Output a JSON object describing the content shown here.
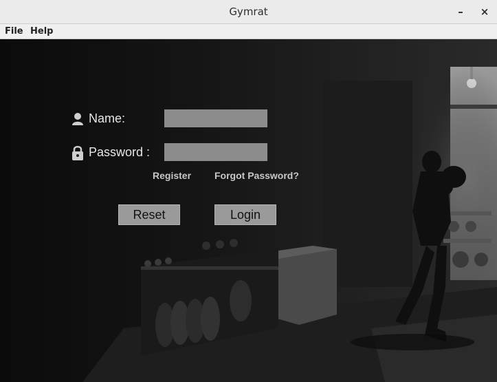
{
  "window": {
    "title": "Gymrat",
    "minimize_glyph": "–",
    "close_glyph": "×"
  },
  "menu": {
    "items": [
      {
        "label": "File"
      },
      {
        "label": "Help"
      }
    ]
  },
  "form": {
    "name_label": "Name:",
    "name_value": "",
    "password_label": "Password :",
    "password_value": "",
    "register_link": "Register",
    "forgot_link": "Forgot Password?",
    "reset_button": "Reset",
    "login_button": "Login",
    "icons": {
      "name": "user-icon",
      "password": "lock-icon"
    }
  },
  "colors": {
    "field_bg": "#8c8c8c",
    "button_bg": "#9a9a9a",
    "label_text": "#e6e6e6"
  }
}
